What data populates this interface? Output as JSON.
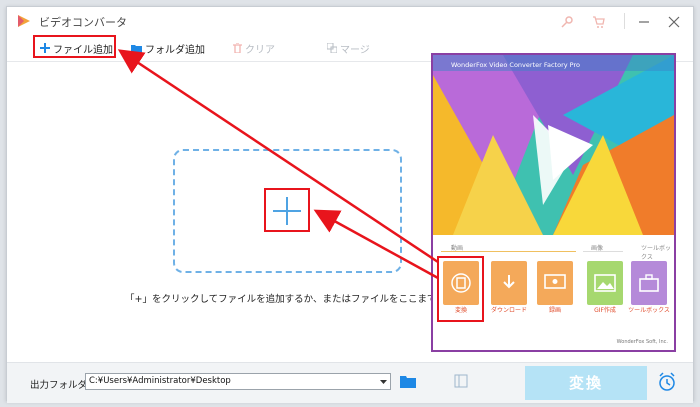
{
  "app": {
    "title": "ビデオコンバータ"
  },
  "toolbar": {
    "add_file": "ファイル追加",
    "add_folder": "フォルダ追加",
    "clear": "クリア",
    "merge": "マージ"
  },
  "drop_zone": {
    "hint": "「+」をクリックしてファイルを追加するか、またはファイルをここまでドラッグし..."
  },
  "bottom": {
    "output_label": "出力フォルダ：",
    "output_path": "C:¥Users¥Administrator¥Desktop",
    "convert": "変換"
  },
  "inset": {
    "title": "WonderFox Video Converter Factory Pro",
    "sections": {
      "video": "動画",
      "image": "画像",
      "toolbox": "ツールボックス"
    },
    "tiles": [
      "変換",
      "ダウンロード",
      "録画",
      "GIF作成",
      "ツールボックス"
    ],
    "footer": "WonderFox Soft, Inc."
  },
  "colors": {
    "highlight": "#e8141c",
    "accent": "#1e88e5",
    "convert_bg": "#b5e3f6"
  }
}
